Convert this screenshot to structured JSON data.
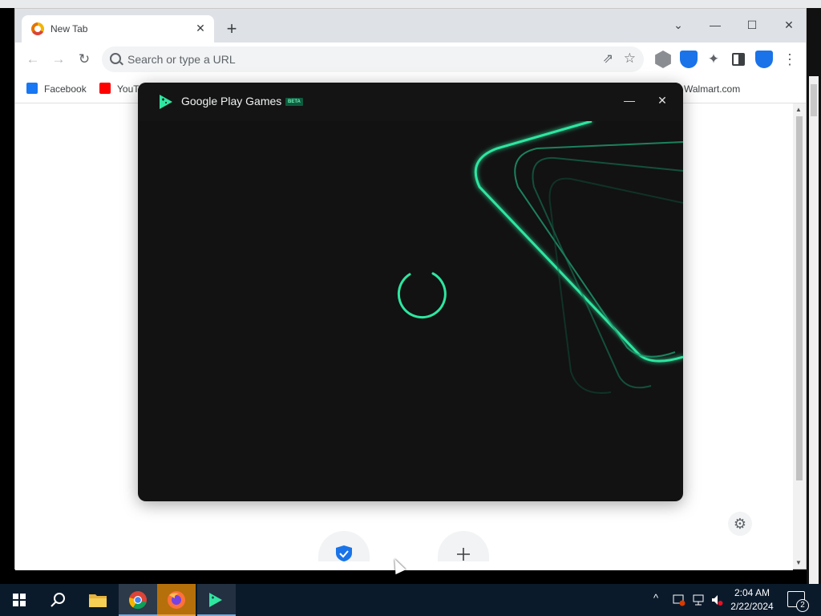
{
  "browser": {
    "tab_title": "New Tab",
    "tab_close": "✕",
    "new_tab": "+",
    "window_controls": {
      "dropdown": "⌄",
      "minimize": "—",
      "maximize": "☐",
      "close": "✕"
    },
    "nav": {
      "back": "←",
      "forward": "→",
      "reload": "↻"
    },
    "omnibox_placeholder": "Search or type a URL",
    "omnibox_share": "⇗",
    "omnibox_star": "☆",
    "extensions": [
      "extension-shield-gray-icon",
      "extension-lock-blue-icon",
      "extensions-puzzle-icon",
      "side-panel-icon",
      "extension-shield-check-icon"
    ],
    "menu": "⋮",
    "bookmarks": [
      {
        "label": "Facebook",
        "icon": "facebook-icon",
        "color": "#1877f2"
      },
      {
        "label": "YouT",
        "icon": "youtube-icon",
        "color": "#ff0000"
      },
      {
        "label": "Walmart.com",
        "icon": "walmart-icon",
        "color": "#0071ce"
      }
    ]
  },
  "dialog": {
    "title": "Google Play Games",
    "badge": "BETA",
    "minimize": "—",
    "close": "✕",
    "state": "loading",
    "accent": "#2ee6a0",
    "background": "#121212"
  },
  "page": {
    "settings_icon": "⚙",
    "shortcuts": [
      "shield-check-shortcut-icon",
      "add-shortcut-icon"
    ]
  },
  "taskbar": {
    "apps": [
      "start-icon",
      "search-icon",
      "file-explorer-icon",
      "chrome-icon",
      "firefox-icon",
      "google-play-games-icon"
    ],
    "time": "2:04 AM",
    "date": "2/22/2024",
    "notification_count": "2",
    "tray_chevron": "^",
    "accent": "#0b1a2b"
  }
}
